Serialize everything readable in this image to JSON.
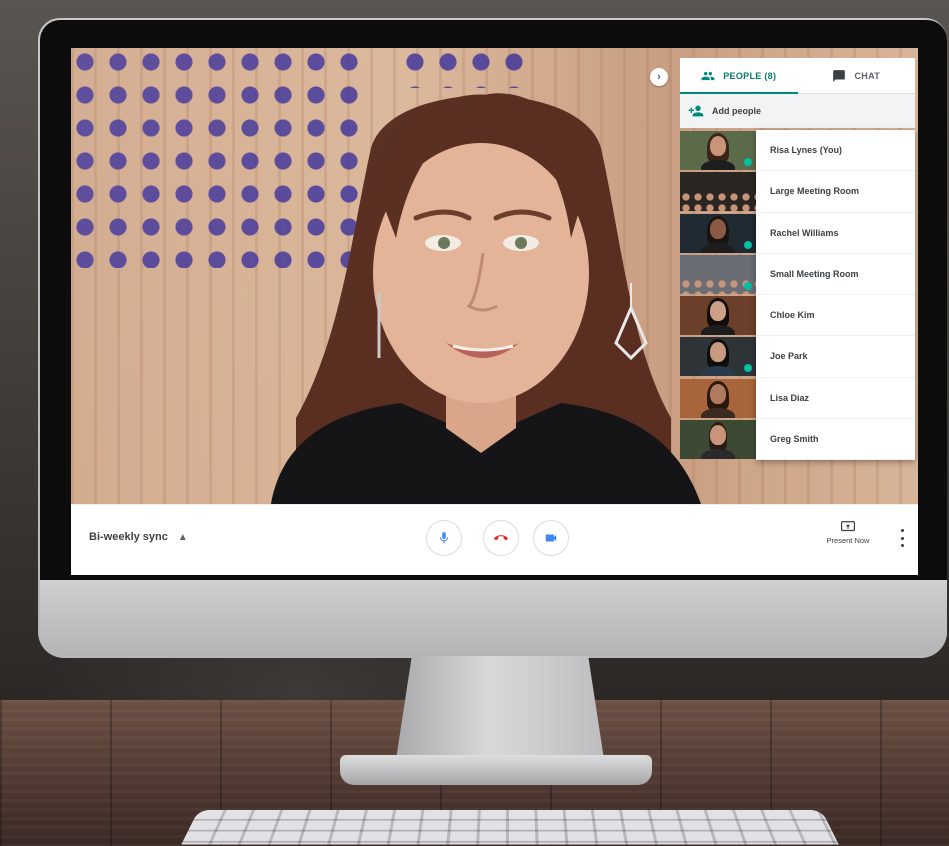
{
  "meeting": {
    "name": "Bi-weekly sync"
  },
  "panel": {
    "tabs": [
      {
        "label": "PEOPLE (8)",
        "icon": "people-icon",
        "active": true
      },
      {
        "label": "CHAT",
        "icon": "chat-icon",
        "active": false
      }
    ],
    "add_people_label": "Add people",
    "participants": [
      {
        "name": "Risa Lynes (You)",
        "speaking": true
      },
      {
        "name": "Large Meeting Room",
        "speaking": false
      },
      {
        "name": "Rachel Williams",
        "speaking": true
      },
      {
        "name": "Small Meeting Room",
        "speaking": true
      },
      {
        "name": "Chloe Kim",
        "speaking": false
      },
      {
        "name": "Joe Park",
        "speaking": true
      },
      {
        "name": "Lisa Diaz",
        "speaking": false
      },
      {
        "name": "Greg Smith",
        "speaking": false
      }
    ]
  },
  "controls": {
    "mic_icon": "microphone-icon",
    "hangup_icon": "hang-up-icon",
    "camera_icon": "camera-icon",
    "present_label": "Present Now",
    "present_icon": "present-screen-icon",
    "more_icon": "more-vertical-icon"
  },
  "colors": {
    "accent": "#00897b",
    "hangup": "#d93025",
    "mic": "#4285f4",
    "speaking_indicator": "#00bfa5"
  }
}
